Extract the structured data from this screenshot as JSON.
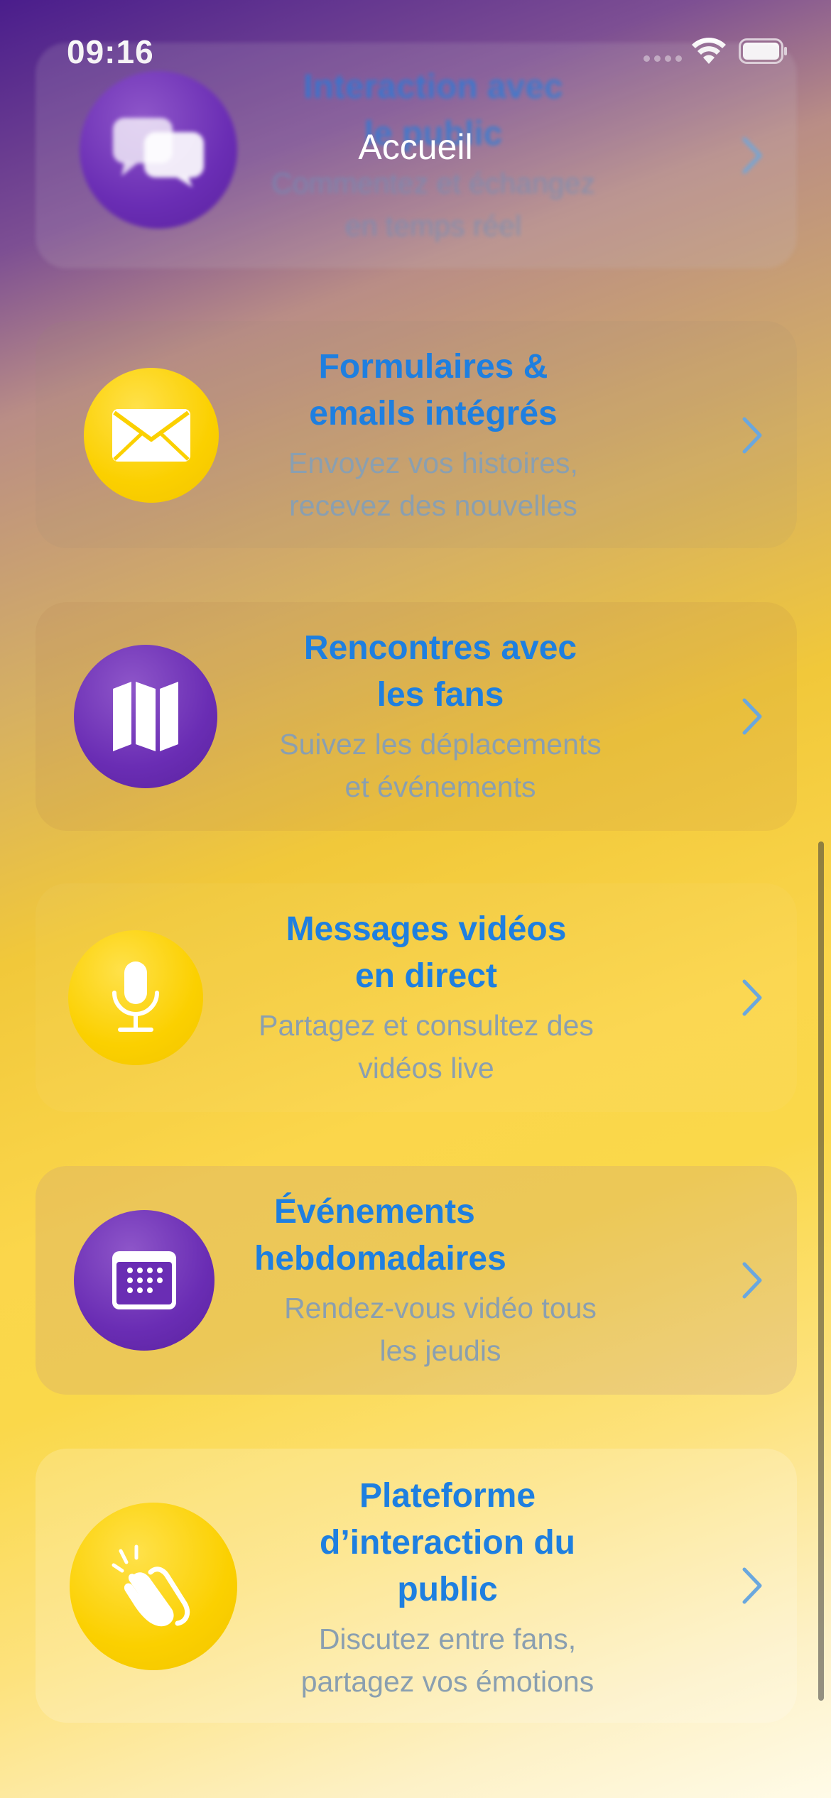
{
  "status_bar": {
    "time": "09:16"
  },
  "nav": {
    "title": "Accueil"
  },
  "cards": [
    {
      "title_lines": [
        "Interaction avec",
        "le public"
      ],
      "subtitle_lines": [
        "Commentez et échangez",
        "en temps réel"
      ],
      "icon": "chat-bubbles-icon",
      "icon_color": "purple"
    },
    {
      "title_lines": [
        "Formulaires &",
        "emails intégrés"
      ],
      "subtitle_lines": [
        "Envoyez vos histoires,",
        "recevez des nouvelles"
      ],
      "icon": "envelope-icon",
      "icon_color": "yellow"
    },
    {
      "title_lines": [
        "Rencontres avec",
        "les fans"
      ],
      "subtitle_lines": [
        "Suivez les déplacements",
        "et événements"
      ],
      "icon": "map-icon",
      "icon_color": "purple"
    },
    {
      "title_lines": [
        "Messages vidéos",
        "en direct"
      ],
      "subtitle_lines": [
        "Partagez et consultez des",
        "vidéos live"
      ],
      "icon": "microphone-icon",
      "icon_color": "yellow"
    },
    {
      "title_lines": [
        "Événements",
        "hebdomadaires"
      ],
      "subtitle_lines": [
        "Rendez-vous vidéo tous",
        "les jeudis"
      ],
      "icon": "calendar-icon",
      "icon_color": "purple"
    },
    {
      "title_lines": [
        "Plateforme",
        "d’interaction du",
        "public"
      ],
      "subtitle_lines": [
        "Discutez entre fans,",
        "partagez vos émotions"
      ],
      "icon": "clapping-hands-icon",
      "icon_color": "yellow"
    }
  ],
  "colors": {
    "title": "#1e7fe0",
    "subtitle": "#8a9fb0",
    "purple": "#6a2db4",
    "yellow": "#fbd000",
    "chevron": "#6aa7de"
  }
}
